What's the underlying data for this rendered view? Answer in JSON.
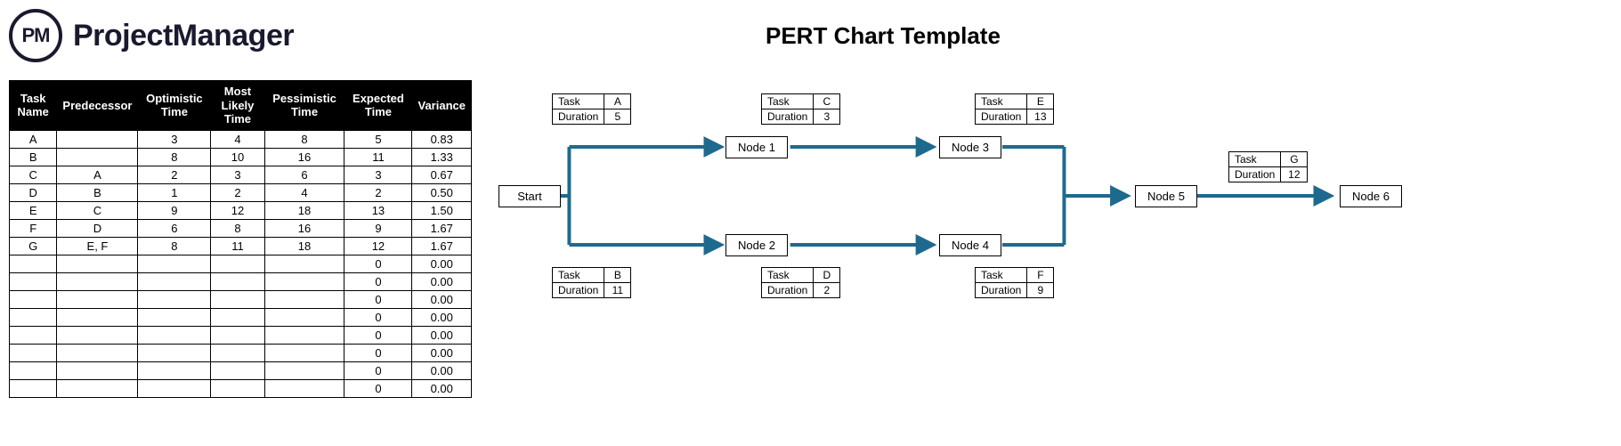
{
  "brand": {
    "logo_initials": "PM",
    "logo_text": "ProjectManager"
  },
  "page_title": "PERT Chart Template",
  "table": {
    "headers": [
      "Task Name",
      "Predecessor",
      "Optimistic Time",
      "Most Likely Time",
      "Pessimistic Time",
      "Expected Time",
      "Variance"
    ],
    "rows": [
      [
        "A",
        "",
        "3",
        "4",
        "8",
        "5",
        "0.83"
      ],
      [
        "B",
        "",
        "8",
        "10",
        "16",
        "11",
        "1.33"
      ],
      [
        "C",
        "A",
        "2",
        "3",
        "6",
        "3",
        "0.67"
      ],
      [
        "D",
        "B",
        "1",
        "2",
        "4",
        "2",
        "0.50"
      ],
      [
        "E",
        "C",
        "9",
        "12",
        "18",
        "13",
        "1.50"
      ],
      [
        "F",
        "D",
        "6",
        "8",
        "16",
        "9",
        "1.67"
      ],
      [
        "G",
        "E, F",
        "8",
        "11",
        "18",
        "12",
        "1.67"
      ],
      [
        "",
        "",
        "",
        "",
        "",
        "0",
        "0.00"
      ],
      [
        "",
        "",
        "",
        "",
        "",
        "0",
        "0.00"
      ],
      [
        "",
        "",
        "",
        "",
        "",
        "0",
        "0.00"
      ],
      [
        "",
        "",
        "",
        "",
        "",
        "0",
        "0.00"
      ],
      [
        "",
        "",
        "",
        "",
        "",
        "0",
        "0.00"
      ],
      [
        "",
        "",
        "",
        "",
        "",
        "0",
        "0.00"
      ],
      [
        "",
        "",
        "",
        "",
        "",
        "0",
        "0.00"
      ],
      [
        "",
        "",
        "",
        "",
        "",
        "0",
        "0.00"
      ]
    ]
  },
  "diagram": {
    "labels": {
      "task": "Task",
      "duration": "Duration"
    },
    "nodes": {
      "start": "Start",
      "n1": "Node 1",
      "n2": "Node 2",
      "n3": "Node 3",
      "n4": "Node 4",
      "n5": "Node 5",
      "n6": "Node 6"
    },
    "info": {
      "a": {
        "task": "A",
        "duration": "5"
      },
      "b": {
        "task": "B",
        "duration": "11"
      },
      "c": {
        "task": "C",
        "duration": "3"
      },
      "d": {
        "task": "D",
        "duration": "2"
      },
      "e": {
        "task": "E",
        "duration": "13"
      },
      "f": {
        "task": "F",
        "duration": "9"
      },
      "g": {
        "task": "G",
        "duration": "12"
      }
    }
  },
  "chart_data": {
    "type": "pert-network",
    "title": "PERT Chart Template",
    "tasks": [
      {
        "name": "A",
        "predecessors": [],
        "optimistic": 3,
        "most_likely": 4,
        "pessimistic": 8,
        "expected": 5,
        "variance": 0.83
      },
      {
        "name": "B",
        "predecessors": [],
        "optimistic": 8,
        "most_likely": 10,
        "pessimistic": 16,
        "expected": 11,
        "variance": 1.33
      },
      {
        "name": "C",
        "predecessors": [
          "A"
        ],
        "optimistic": 2,
        "most_likely": 3,
        "pessimistic": 6,
        "expected": 3,
        "variance": 0.67
      },
      {
        "name": "D",
        "predecessors": [
          "B"
        ],
        "optimistic": 1,
        "most_likely": 2,
        "pessimistic": 4,
        "expected": 2,
        "variance": 0.5
      },
      {
        "name": "E",
        "predecessors": [
          "C"
        ],
        "optimistic": 9,
        "most_likely": 12,
        "pessimistic": 18,
        "expected": 13,
        "variance": 1.5
      },
      {
        "name": "F",
        "predecessors": [
          "D"
        ],
        "optimistic": 6,
        "most_likely": 8,
        "pessimistic": 16,
        "expected": 9,
        "variance": 1.67
      },
      {
        "name": "G",
        "predecessors": [
          "E",
          "F"
        ],
        "optimistic": 8,
        "most_likely": 11,
        "pessimistic": 18,
        "expected": 12,
        "variance": 1.67
      }
    ],
    "nodes": [
      "Start",
      "Node 1",
      "Node 2",
      "Node 3",
      "Node 4",
      "Node 5",
      "Node 6"
    ],
    "edges": [
      {
        "from": "Start",
        "to": "Node 1",
        "task": "A",
        "duration": 5
      },
      {
        "from": "Start",
        "to": "Node 2",
        "task": "B",
        "duration": 11
      },
      {
        "from": "Node 1",
        "to": "Node 3",
        "task": "C",
        "duration": 3
      },
      {
        "from": "Node 2",
        "to": "Node 4",
        "task": "D",
        "duration": 2
      },
      {
        "from": "Node 3",
        "to": "Node 5",
        "task": "E",
        "duration": 13
      },
      {
        "from": "Node 4",
        "to": "Node 5",
        "task": "F",
        "duration": 9
      },
      {
        "from": "Node 5",
        "to": "Node 6",
        "task": "G",
        "duration": 12
      }
    ]
  }
}
